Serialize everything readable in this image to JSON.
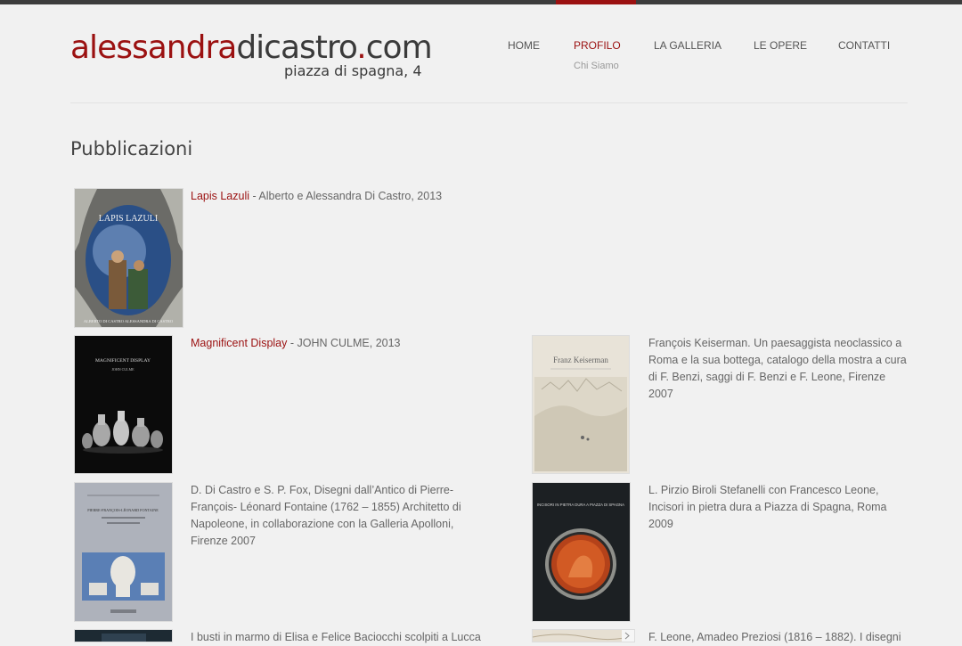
{
  "site": {
    "logo_part1": "alessandra",
    "logo_part2": "dicastro",
    "logo_dot": ".",
    "logo_part3": "com",
    "tagline": "piazza di spagna, 4"
  },
  "nav": {
    "items": [
      {
        "label": "HOME"
      },
      {
        "label": "PROFILO"
      },
      {
        "label": "LA GALLERIA"
      },
      {
        "label": "LE OPERE"
      },
      {
        "label": "CONTATTI"
      }
    ],
    "active_sub": "Chi Siamo"
  },
  "page": {
    "title": "Pubblicazioni"
  },
  "publications": [
    {
      "title": "Lapis Lazuli",
      "rest": " - Alberto e Alessandra Di Castro, 2013",
      "cover_title": "LAPIS LAZULI",
      "cover_footer": "ALBERTO DI CASTRO   ALESSANDRA DI CASTRO"
    },
    {
      "title": "Magnificent Display",
      "rest": " - JOHN CULME, 2013",
      "cover_title": "MAGNIFICENT DISPLAY",
      "cover_sub": "JOHN CULME"
    },
    {
      "text": "François Keiserman. Un paesaggista neoclassico a Roma e la sua bottega, catalogo della mostra a cura di F. Benzi, saggi di F. Benzi e F. Leone, Firenze 2007",
      "cover_title": "Franz Keiserman"
    },
    {
      "text": "D. Di Castro e S. P. Fox, Disegni dall’Antico di Pierre-François- Léonard Fontaine (1762 – 1855) Architetto di Napoleone, in collaborazione con la Galleria Apolloni, Firenze 2007",
      "cover_title": "PIERRE-FRANÇOIS-LÉONARD FONTAINE"
    },
    {
      "text": "L. Pirzio Biroli Stefanelli con Francesco Leone, Incisori in pietra dura a Piazza di Spagna, Roma 2009",
      "cover_title": "INCISORI IN PIETRA DURA A PIAZZA DI SPAGNA"
    },
    {
      "text": "I busti in marmo di Elisa e Felice Baciocchi scolpiti a Lucca"
    },
    {
      "text": "F. Leone, Amadeo Preziosi (1816 – 1882). I disegni"
    }
  ]
}
